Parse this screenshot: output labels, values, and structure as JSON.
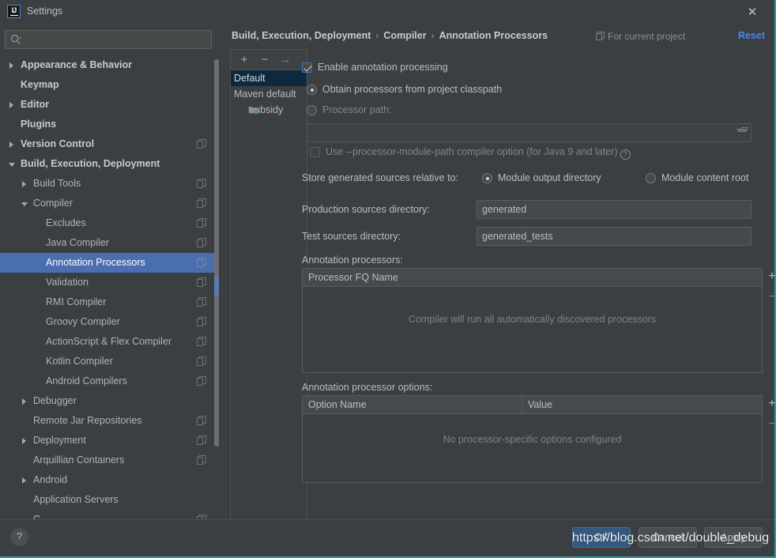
{
  "window": {
    "title": "Settings",
    "logo_text": "IJ",
    "close_icon": "✕"
  },
  "sidebar": {
    "search_placeholder": "",
    "search_value": "",
    "items": [
      {
        "label": "Appearance & Behavior",
        "indent": 0,
        "arrow": "closed",
        "bold": true,
        "copy": false,
        "selected": false
      },
      {
        "label": "Keymap",
        "indent": 0,
        "arrow": "none",
        "bold": true,
        "copy": false,
        "selected": false
      },
      {
        "label": "Editor",
        "indent": 0,
        "arrow": "closed",
        "bold": true,
        "copy": false,
        "selected": false
      },
      {
        "label": "Plugins",
        "indent": 0,
        "arrow": "none",
        "bold": true,
        "copy": false,
        "selected": false
      },
      {
        "label": "Version Control",
        "indent": 0,
        "arrow": "closed",
        "bold": true,
        "copy": true,
        "selected": false
      },
      {
        "label": "Build, Execution, Deployment",
        "indent": 0,
        "arrow": "open",
        "bold": true,
        "copy": false,
        "selected": false
      },
      {
        "label": "Build Tools",
        "indent": 1,
        "arrow": "closed",
        "bold": false,
        "copy": true,
        "selected": false
      },
      {
        "label": "Compiler",
        "indent": 1,
        "arrow": "open",
        "bold": false,
        "copy": true,
        "selected": false
      },
      {
        "label": "Excludes",
        "indent": 2,
        "arrow": "none",
        "bold": false,
        "copy": true,
        "selected": false
      },
      {
        "label": "Java Compiler",
        "indent": 2,
        "arrow": "none",
        "bold": false,
        "copy": true,
        "selected": false
      },
      {
        "label": "Annotation Processors",
        "indent": 2,
        "arrow": "none",
        "bold": false,
        "copy": true,
        "selected": true
      },
      {
        "label": "Validation",
        "indent": 2,
        "arrow": "none",
        "bold": false,
        "copy": true,
        "selected": false
      },
      {
        "label": "RMI Compiler",
        "indent": 2,
        "arrow": "none",
        "bold": false,
        "copy": true,
        "selected": false
      },
      {
        "label": "Groovy Compiler",
        "indent": 2,
        "arrow": "none",
        "bold": false,
        "copy": true,
        "selected": false
      },
      {
        "label": "ActionScript & Flex Compiler",
        "indent": 2,
        "arrow": "none",
        "bold": false,
        "copy": true,
        "selected": false
      },
      {
        "label": "Kotlin Compiler",
        "indent": 2,
        "arrow": "none",
        "bold": false,
        "copy": true,
        "selected": false
      },
      {
        "label": "Android Compilers",
        "indent": 2,
        "arrow": "none",
        "bold": false,
        "copy": true,
        "selected": false
      },
      {
        "label": "Debugger",
        "indent": 1,
        "arrow": "closed",
        "bold": false,
        "copy": false,
        "selected": false
      },
      {
        "label": "Remote Jar Repositories",
        "indent": 1,
        "arrow": "none",
        "bold": false,
        "copy": true,
        "selected": false
      },
      {
        "label": "Deployment",
        "indent": 1,
        "arrow": "closed",
        "bold": false,
        "copy": true,
        "selected": false
      },
      {
        "label": "Arquillian Containers",
        "indent": 1,
        "arrow": "none",
        "bold": false,
        "copy": true,
        "selected": false
      },
      {
        "label": "Android",
        "indent": 1,
        "arrow": "closed",
        "bold": false,
        "copy": false,
        "selected": false
      },
      {
        "label": "Application Servers",
        "indent": 1,
        "arrow": "none",
        "bold": false,
        "copy": false,
        "selected": false
      },
      {
        "label": "C",
        "indent": 1,
        "arrow": "none",
        "bold": false,
        "copy": true,
        "selected": false
      }
    ]
  },
  "header": {
    "breadcrumb": [
      "Build, Execution, Deployment",
      "Compiler",
      "Annotation Processors"
    ],
    "separator": "›",
    "for_current_project": "For current project",
    "reset_label": "Reset"
  },
  "profiles": {
    "toolbar": {
      "add": "+",
      "remove": "−",
      "move": "→"
    },
    "items": [
      {
        "label": "Default",
        "selected": true,
        "child": false
      },
      {
        "label": "Maven default",
        "selected": false,
        "child": false
      },
      {
        "label": "subsidy",
        "selected": false,
        "child": true
      }
    ]
  },
  "form": {
    "enable_annotation_processing": {
      "label": "Enable annotation processing",
      "checked": true
    },
    "processor_source": {
      "selected": "classpath",
      "options": [
        {
          "id": "classpath",
          "label": "Obtain processors from project classpath"
        },
        {
          "id": "path",
          "label": "Processor path:"
        }
      ]
    },
    "processor_path": {
      "value": "",
      "placeholder": "",
      "enabled": false
    },
    "processor_module_path": {
      "label": "Use --processor-module-path compiler option (for Java 9 and later)",
      "checked": false,
      "enabled": false,
      "help": "?"
    },
    "store_generated_label": "Store generated sources relative to:",
    "store_generated": {
      "selected": "module_output",
      "options": [
        {
          "id": "module_output",
          "label": "Module output directory"
        },
        {
          "id": "content_root",
          "label": "Module content root"
        }
      ]
    },
    "production_sources": {
      "label": "Production sources directory:",
      "value": "generated"
    },
    "test_sources": {
      "label": "Test sources directory:",
      "value": "generated_tests"
    },
    "processors_table": {
      "caption": "Annotation processors:",
      "columns": [
        "Processor FQ Name"
      ],
      "rows": [],
      "empty_text": "Compiler will run all automatically discovered processors",
      "add": "+",
      "remove": "−"
    },
    "options_table": {
      "caption": "Annotation processor options:",
      "columns": [
        "Option Name",
        "Value"
      ],
      "rows": [],
      "empty_text": "No processor-specific options configured",
      "add": "+",
      "remove": "−"
    }
  },
  "footer": {
    "help": "?",
    "ok": "OK",
    "cancel": "Cancel",
    "apply": "Apply"
  },
  "watermark": "https://blog.csdn.net/double_debug",
  "colors": {
    "background": "#3c3f41",
    "selection": "#4b6eaf",
    "accent_link": "#4287f5",
    "primary_button": "#365880",
    "border_accent": "#1c9fb0"
  }
}
